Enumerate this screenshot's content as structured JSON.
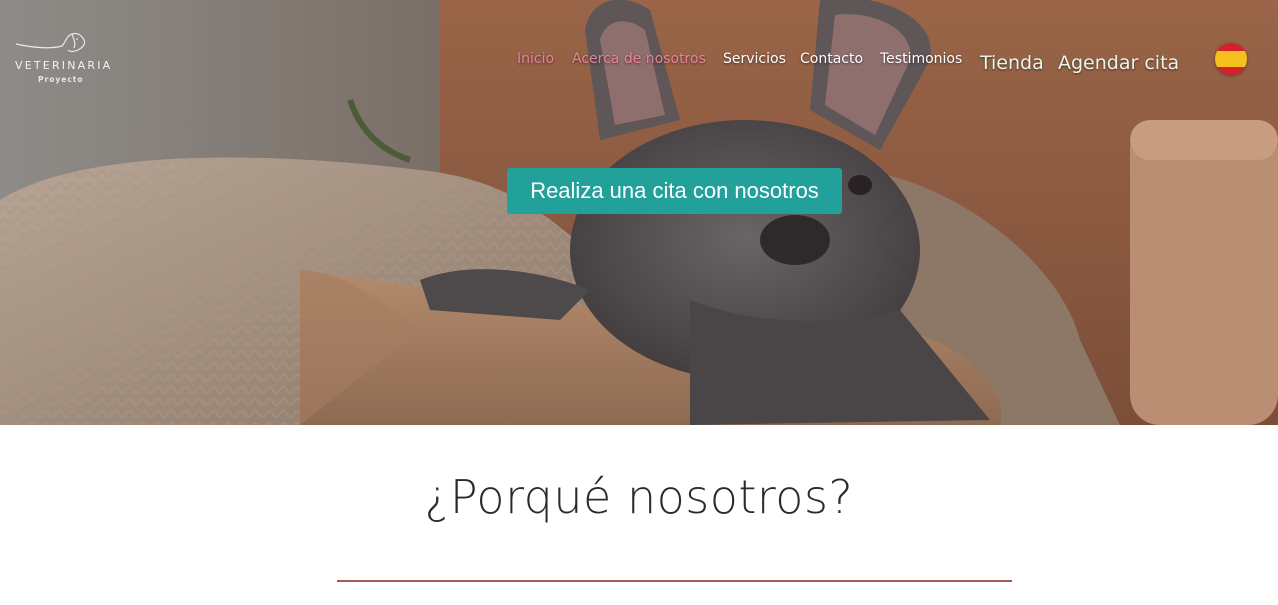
{
  "brand": {
    "name": "VETERINARIA",
    "subtitle": "Proyecto",
    "logo_icon": "dog-line-icon"
  },
  "nav": {
    "items": [
      {
        "label": "Inicio",
        "color": "#e8849a"
      },
      {
        "label": "Acerca de nosotros",
        "color": "#e8849a"
      },
      {
        "label": "Servicios",
        "color": "#ffffff"
      },
      {
        "label": "Contacto",
        "color": "#ffffff"
      },
      {
        "label": "Testimonios",
        "color": "#ffffff"
      },
      {
        "label": "Tienda",
        "color": "#e7f6ea"
      },
      {
        "label": "Agendar cita",
        "color": "#e7f6ea"
      }
    ],
    "language_icon": "spain-flag-icon"
  },
  "hero": {
    "cta_label": "Realiza una cita con nosotros",
    "cta_color": "#22a09a",
    "image": "french-bulldog-on-sofa-photo"
  },
  "section": {
    "title": "¿Porqué nosotros?",
    "divider_color": "#a65a55"
  }
}
